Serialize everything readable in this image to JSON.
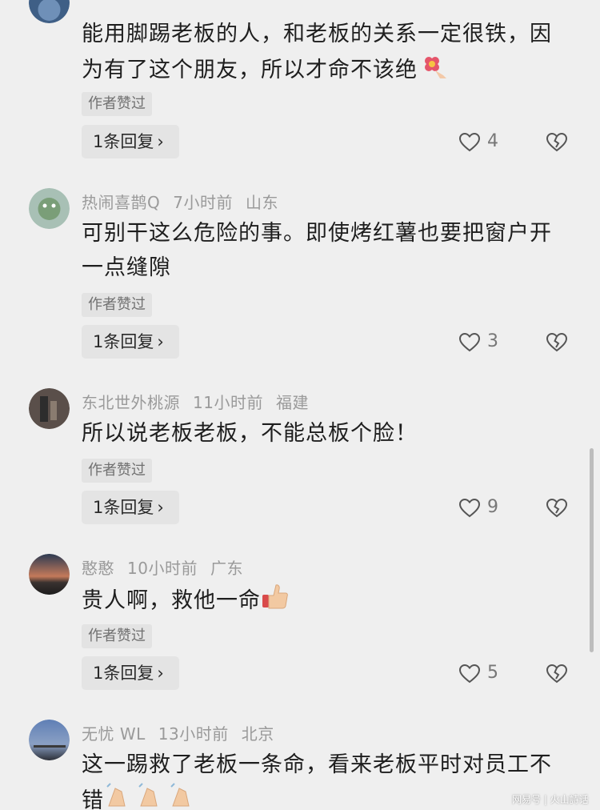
{
  "comments": [
    {
      "username": "",
      "time": "",
      "location": "",
      "text_line1": "能用脚踢老板的人，和老板的关系一定很铁，因",
      "text_line2": "为有了这个朋友，所以才命不该绝",
      "emoji": "flower-emoji",
      "author_liked": "作者赞过",
      "reply_label": "1条回复",
      "like_count": "4"
    },
    {
      "username": "热闹喜鹊Q",
      "time": "7小时前",
      "location": "山东",
      "text_line1": "可别干这么危险的事。即使烤红薯也要把窗户开",
      "text_line2": "一点缝隙",
      "author_liked": "作者赞过",
      "reply_label": "1条回复",
      "like_count": "3"
    },
    {
      "username": "东北世外桃源",
      "time": "11小时前",
      "location": "福建",
      "text_line1": "所以说老板老板，不能总板个脸！",
      "author_liked": "作者赞过",
      "reply_label": "1条回复",
      "like_count": "9"
    },
    {
      "username": "憨憨",
      "time": "10小时前",
      "location": "广东",
      "text_line1": "贵人啊，救他一命",
      "emoji": "thumbs-up-emoji",
      "author_liked": "作者赞过",
      "reply_label": "1条回复",
      "like_count": "5"
    },
    {
      "username": "无忧 WL",
      "time": "13小时前",
      "location": "北京",
      "text_line1": "这一踢救了老板一条命，看来老板平时对员工不",
      "text_line2": "错",
      "emoji": "clapping-hands-emoji"
    }
  ],
  "chevron": "›",
  "watermark": "网易号 | 火山詩话"
}
